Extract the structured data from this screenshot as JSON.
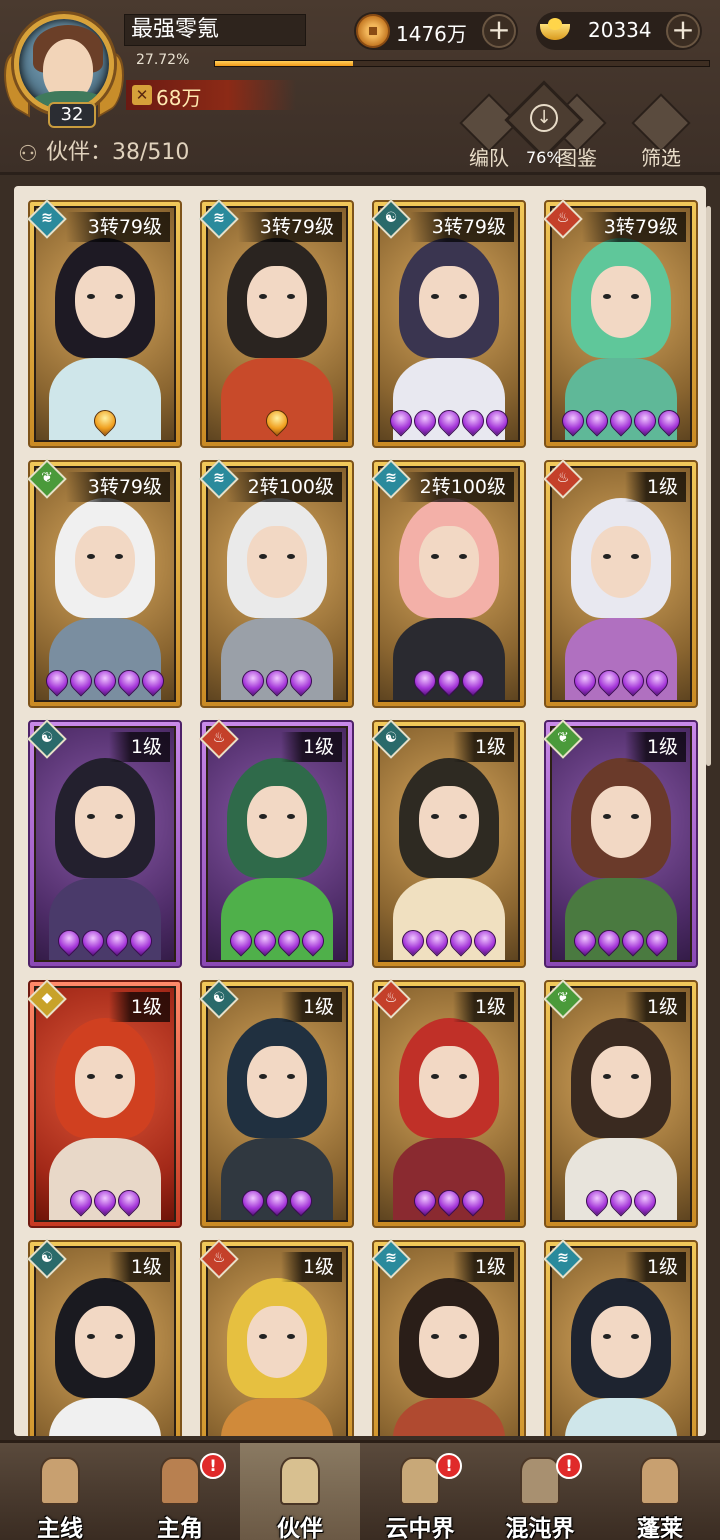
{
  "player": {
    "name": "最强零氪",
    "level": "32",
    "exp_percent_text": "27.72%",
    "exp_fraction": 0.28,
    "power": "68万"
  },
  "currencies": [
    {
      "icon": "copper-coin-icon",
      "value": "1476万"
    },
    {
      "icon": "gold-ingot-icon",
      "value": "20334"
    }
  ],
  "partners": {
    "label": "伙伴：",
    "count": "38/510"
  },
  "toolbar": {
    "formation": "编队",
    "handbook": "图鉴",
    "filter": "筛选",
    "percent": "76%"
  },
  "cards": [
    {
      "level": "3转79级",
      "element": "water",
      "frame": "gold",
      "stars": 1,
      "star_type": "flame"
    },
    {
      "level": "3转79级",
      "element": "water",
      "frame": "gold",
      "stars": 1,
      "star_type": "flame"
    },
    {
      "level": "3转79级",
      "element": "dark",
      "frame": "gold",
      "stars": 5,
      "star_type": "purple"
    },
    {
      "level": "3转79级",
      "element": "fire",
      "frame": "gold",
      "stars": 5,
      "star_type": "purple"
    },
    {
      "level": "3转79级",
      "element": "wood",
      "frame": "gold",
      "stars": 5,
      "star_type": "purple"
    },
    {
      "level": "2转100级",
      "element": "water",
      "frame": "gold",
      "stars": 3,
      "star_type": "purple"
    },
    {
      "level": "2转100级",
      "element": "water",
      "frame": "gold",
      "stars": 3,
      "star_type": "purple"
    },
    {
      "level": "1级",
      "element": "fire",
      "frame": "gold",
      "stars": 4,
      "star_type": "purple"
    },
    {
      "level": "1级",
      "element": "dark",
      "frame": "purple",
      "stars": 4,
      "star_type": "purple"
    },
    {
      "level": "1级",
      "element": "fire",
      "frame": "purple",
      "stars": 4,
      "star_type": "purple"
    },
    {
      "level": "1级",
      "element": "dark",
      "frame": "gold",
      "stars": 4,
      "star_type": "purple"
    },
    {
      "level": "1级",
      "element": "wood",
      "frame": "purple",
      "stars": 4,
      "star_type": "purple"
    },
    {
      "level": "1级",
      "element": "gold",
      "frame": "red",
      "stars": 3,
      "star_type": "purple"
    },
    {
      "level": "1级",
      "element": "dark",
      "frame": "gold",
      "stars": 3,
      "star_type": "purple"
    },
    {
      "level": "1级",
      "element": "fire",
      "frame": "gold",
      "stars": 3,
      "star_type": "purple"
    },
    {
      "level": "1级",
      "element": "wood",
      "frame": "gold",
      "stars": 3,
      "star_type": "purple"
    },
    {
      "level": "1级",
      "element": "dark",
      "frame": "gold",
      "stars": 0,
      "star_type": "purple"
    },
    {
      "level": "1级",
      "element": "fire",
      "frame": "gold",
      "stars": 0,
      "star_type": "purple"
    },
    {
      "level": "1级",
      "element": "water",
      "frame": "gold",
      "stars": 0,
      "star_type": "purple"
    },
    {
      "level": "1级",
      "element": "water",
      "frame": "gold",
      "stars": 0,
      "star_type": "purple"
    }
  ],
  "nav": [
    {
      "label": "主线",
      "icon": "crossed-swords-icon",
      "badge": ""
    },
    {
      "label": "主角",
      "icon": "hero-portrait-icon",
      "badge": "!"
    },
    {
      "label": "伙伴",
      "icon": "partner-helmet-icon",
      "badge": "",
      "active": true
    },
    {
      "label": "云中界",
      "icon": "cloud-temple-icon",
      "badge": "!"
    },
    {
      "label": "混沌界",
      "icon": "chaos-shrine-icon",
      "badge": "!"
    },
    {
      "label": "蓬莱",
      "icon": "penglai-palace-icon",
      "badge": ""
    }
  ]
}
